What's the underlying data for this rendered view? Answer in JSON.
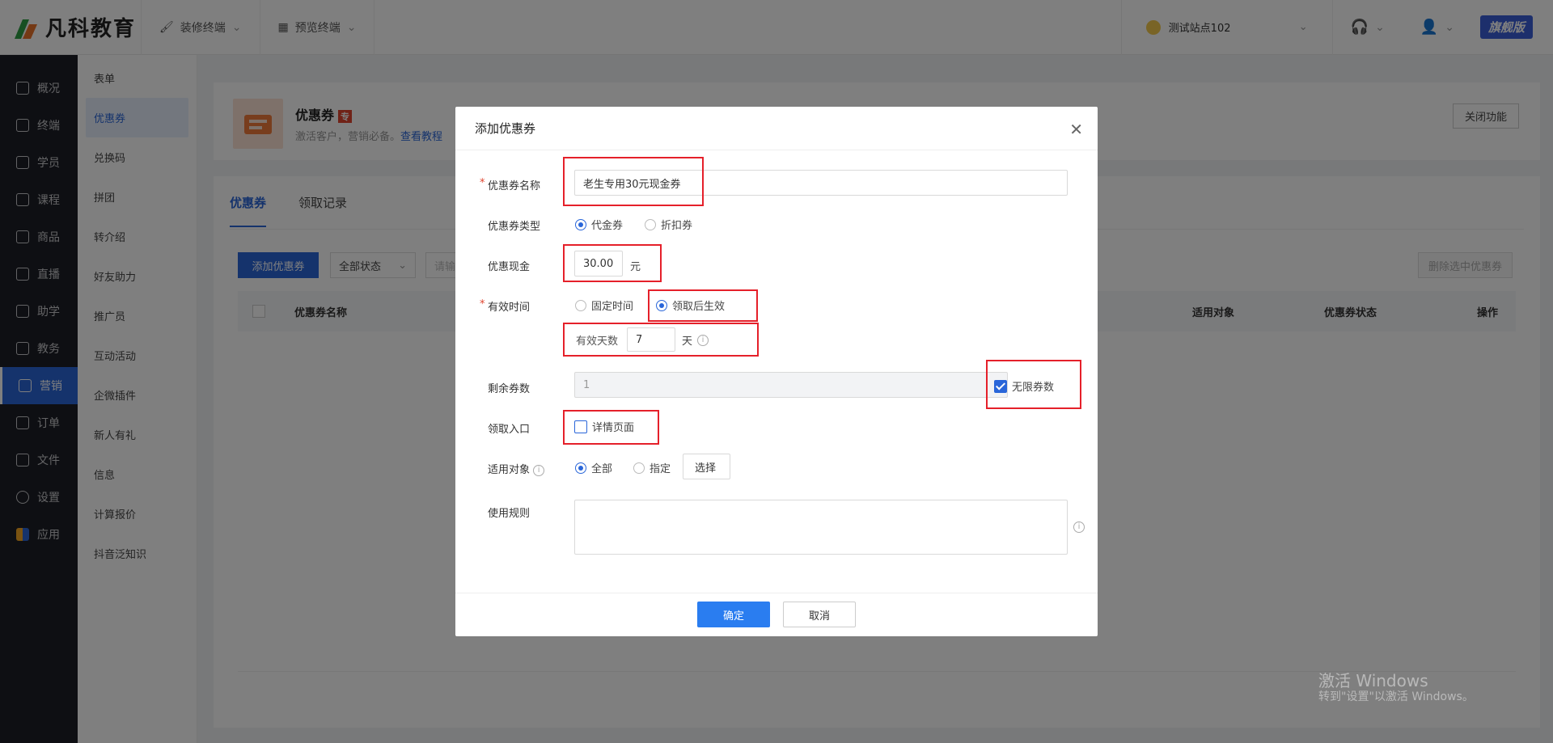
{
  "brand": {
    "name": "凡科教育",
    "colors": {
      "accent": "#2a66d9",
      "logo_orange": "#e8732a",
      "logo_green": "#2f9e44"
    }
  },
  "topnav": {
    "decorate": "装修终端",
    "preview": "预览终端"
  },
  "topright": {
    "site": "测试站点102",
    "edition": "旗舰版"
  },
  "sidebar": {
    "items": [
      {
        "label": "概况",
        "icon": "grid-icon"
      },
      {
        "label": "终端",
        "icon": "store-icon"
      },
      {
        "label": "学员",
        "icon": "users-icon"
      },
      {
        "label": "课程",
        "icon": "course-icon"
      },
      {
        "label": "商品",
        "icon": "goods-icon"
      },
      {
        "label": "直播",
        "icon": "live-icon"
      },
      {
        "label": "助学",
        "icon": "study-icon"
      },
      {
        "label": "教务",
        "icon": "book-icon"
      },
      {
        "label": "营销",
        "icon": "marketing-icon"
      },
      {
        "label": "订单",
        "icon": "order-icon"
      },
      {
        "label": "文件",
        "icon": "folder-icon"
      },
      {
        "label": "设置",
        "icon": "gear-icon"
      },
      {
        "label": "应用",
        "icon": "apps-icon"
      }
    ]
  },
  "subnav": {
    "items": [
      "表单",
      "优惠券",
      "兑换码",
      "拼团",
      "转介绍",
      "好友助力",
      "推广员",
      "互动活动",
      "企微插件",
      "新人有礼",
      "信息",
      "计算报价",
      "抖音泛知识"
    ]
  },
  "feature": {
    "title": "优惠券",
    "badge": "专",
    "desc": "激活客户，营销必备。",
    "link": "查看教程",
    "close_button": "关闭功能"
  },
  "tabs": [
    "优惠券",
    "领取记录"
  ],
  "toolbar": {
    "add_button": "添加优惠券",
    "status_filter": "全部状态",
    "search_placeholder": "请输",
    "delete_selected": "删除选中优惠券"
  },
  "table": {
    "headers": {
      "name": "优惠券名称",
      "target": "适用对象",
      "status": "优惠券状态",
      "action": "操作"
    }
  },
  "modal": {
    "title": "添加优惠券",
    "name_label": "优惠券名称",
    "name_value": "老生专用30元现金券",
    "type_label": "优惠券类型",
    "type_opt1": "代金券",
    "type_opt2": "折扣券",
    "cash_label": "优惠现金",
    "cash_value": "30.00",
    "cash_unit": "元",
    "valid_label": "有效时间",
    "valid_opt1": "固定时间",
    "valid_opt2": "领取后生效",
    "days_label": "有效天数",
    "days_value": "7",
    "days_unit": "天",
    "remain_label": "剩余券数",
    "remain_value": "1",
    "unlimited_label": "无限券数",
    "entry_label": "领取入口",
    "entry_opt": "详情页面",
    "target_label": "适用对象",
    "target_opt1": "全部",
    "target_opt2": "指定",
    "select_button": "选择",
    "rules_label": "使用规则",
    "ok_button": "确定",
    "cancel_button": "取消"
  },
  "watermark": {
    "line1": "激活 Windows",
    "line2": "转到\"设置\"以激活 Windows。"
  }
}
